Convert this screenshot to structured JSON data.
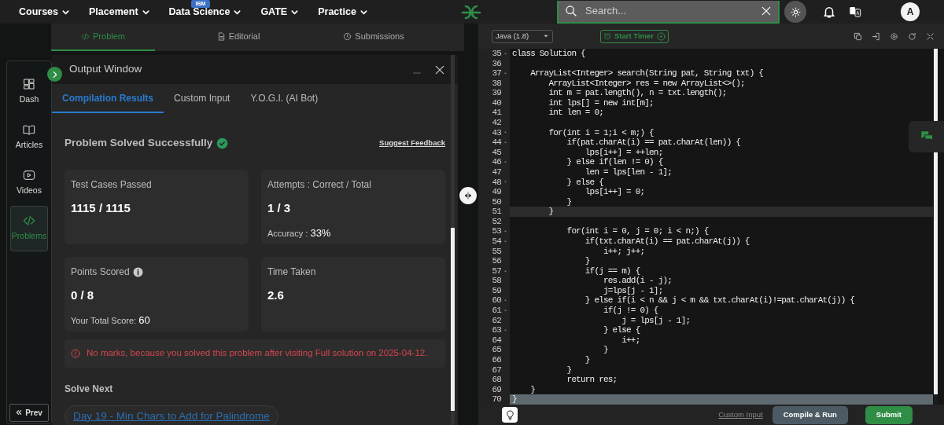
{
  "nav": {
    "items": [
      {
        "label": "Courses"
      },
      {
        "label": "Placement"
      },
      {
        "label": "Data Science",
        "badge": "IBM"
      },
      {
        "label": "GATE"
      },
      {
        "label": "Practice"
      }
    ],
    "search": {
      "placeholder": "Search..."
    },
    "avatar": "A"
  },
  "problem_tabs": [
    {
      "label": "Problem",
      "selected": true
    },
    {
      "label": "Editorial",
      "selected": false
    },
    {
      "label": "Submissions",
      "selected": false
    }
  ],
  "sidebar": {
    "items": [
      {
        "label": "Dash",
        "selected": false
      },
      {
        "label": "Articles",
        "selected": false
      },
      {
        "label": "Videos",
        "selected": false
      },
      {
        "label": "Problems",
        "selected": true
      }
    ],
    "prev": "Prev"
  },
  "output_window": {
    "title": "Output Window",
    "tabs": [
      {
        "label": "Compilation Results",
        "selected": true
      },
      {
        "label": "Custom Input",
        "selected": false
      },
      {
        "label": "Y.O.G.I. (AI Bot)",
        "selected": false
      }
    ],
    "status": "Problem Solved Successfully",
    "feedback_link": "Suggest Feedback",
    "stats": [
      {
        "label": "Test Cases Passed",
        "info": false,
        "value": "1115 / 1115"
      },
      {
        "label": "Attempts : Correct / Total",
        "info": false,
        "value": "1 / 3",
        "detail_label": "Accuracy :",
        "detail_value": "33%"
      },
      {
        "label": "Points Scored",
        "info": true,
        "value": "0 / 8",
        "detail_label": "Your Total Score:",
        "detail_value": "60"
      },
      {
        "label": "Time Taken",
        "info": false,
        "value": "2.6"
      }
    ],
    "alert": "No marks, because you solved this problem after visiting Full solution on 2025-04-12.",
    "solve_next": {
      "heading": "Solve Next",
      "items": [
        "Day 19 - Min Chars to Add for Palindrome"
      ]
    }
  },
  "editor": {
    "language": "Java (1.8)",
    "timer": "Start Timer",
    "lines": [
      {
        "number": "35",
        "text": "class Solution {",
        "fold": true,
        "current": false,
        "selected": false
      },
      {
        "number": "36",
        "fold": false,
        "current": false,
        "selected": false
      },
      {
        "number": "37",
        "text": "    ArrayList<Integer> search(String pat, String txt) {",
        "fold": true,
        "current": false,
        "selected": false
      },
      {
        "number": "38",
        "text": "        ArrayList<Integer> res = new ArrayList<>();",
        "fold": false,
        "current": false,
        "selected": false
      },
      {
        "number": "39",
        "text": "        int m = pat.length(), n = txt.length();",
        "fold": false,
        "current": false,
        "selected": false
      },
      {
        "number": "40",
        "text": "        int lps[] = new int[m];",
        "fold": false,
        "current": false,
        "selected": false
      },
      {
        "number": "41",
        "text": "        int len = 0;",
        "fold": false,
        "current": false,
        "selected": false
      },
      {
        "number": "42",
        "fold": false,
        "current": false,
        "selected": false
      },
      {
        "number": "43",
        "text": "        for(int i = 1;i < m;) {",
        "fold": true,
        "current": false,
        "selected": false
      },
      {
        "number": "44",
        "text": "            if(pat.charAt(i) == pat.charAt(len)) {",
        "fold": true,
        "current": false,
        "selected": false
      },
      {
        "number": "45",
        "text": "                lps[i++] = ++len;",
        "fold": false,
        "current": false,
        "selected": false
      },
      {
        "number": "46",
        "text": "            } else if(len != 0) {",
        "fold": true,
        "current": false,
        "selected": false
      },
      {
        "number": "47",
        "text": "                len = lps[len - 1];",
        "fold": false,
        "current": false,
        "selected": false
      },
      {
        "number": "48",
        "text": "            } else {",
        "fold": true,
        "current": false,
        "selected": false
      },
      {
        "number": "49",
        "text": "                lps[i++] = 0;",
        "fold": false,
        "current": false,
        "selected": false
      },
      {
        "number": "50",
        "text": "            }",
        "fold": false,
        "current": false,
        "selected": false
      },
      {
        "number": "51",
        "text": "        }",
        "fold": false,
        "current": true,
        "selected": false
      },
      {
        "number": "52",
        "fold": false,
        "current": false,
        "selected": false
      },
      {
        "number": "53",
        "text": "            for(int i = 0, j = 0; i < n;) {",
        "fold": true,
        "current": false,
        "selected": false
      },
      {
        "number": "54",
        "text": "                if(txt.charAt(i) == pat.charAt(j)) {",
        "fold": true,
        "current": false,
        "selected": false
      },
      {
        "number": "55",
        "text": "                    i++; j++;",
        "fold": false,
        "current": false,
        "selected": false
      },
      {
        "number": "56",
        "text": "                }",
        "fold": false,
        "current": false,
        "selected": false
      },
      {
        "number": "57",
        "text": "                if(j == m) {",
        "fold": true,
        "current": false,
        "selected": false
      },
      {
        "number": "58",
        "text": "                    res.add(i - j);",
        "fold": false,
        "current": false,
        "selected": false
      },
      {
        "number": "59",
        "text": "                    j=lps[j - 1];",
        "fold": false,
        "current": false,
        "selected": false
      },
      {
        "number": "60",
        "text": "                } else if(i < n && j < m && txt.charAt(i)!=pat.charAt(j)) {",
        "fold": true,
        "current": false,
        "selected": false
      },
      {
        "number": "61",
        "text": "                    if(j != 0) {",
        "fold": true,
        "current": false,
        "selected": false
      },
      {
        "number": "62",
        "text": "                        j = lps[j - 1];",
        "fold": false,
        "current": false,
        "selected": false
      },
      {
        "number": "63",
        "text": "                    } else {",
        "fold": true,
        "current": false,
        "selected": false
      },
      {
        "number": "64",
        "text": "                        i++;",
        "fold": false,
        "current": false,
        "selected": false
      },
      {
        "number": "65",
        "text": "                    }",
        "fold": false,
        "current": false,
        "selected": false
      },
      {
        "number": "66",
        "text": "                }",
        "fold": false,
        "current": false,
        "selected": false
      },
      {
        "number": "67",
        "text": "            }",
        "fold": false,
        "current": false,
        "selected": false
      },
      {
        "number": "68",
        "text": "            return res;",
        "fold": false,
        "current": false,
        "selected": false
      },
      {
        "number": "69",
        "text": "    }",
        "fold": false,
        "current": false,
        "selected": false
      },
      {
        "number": "70",
        "text": "}",
        "fold": false,
        "current": false,
        "selected": true
      }
    ],
    "custom_input": "Custom Input",
    "compile": "Compile & Run",
    "submit": "Submit"
  }
}
